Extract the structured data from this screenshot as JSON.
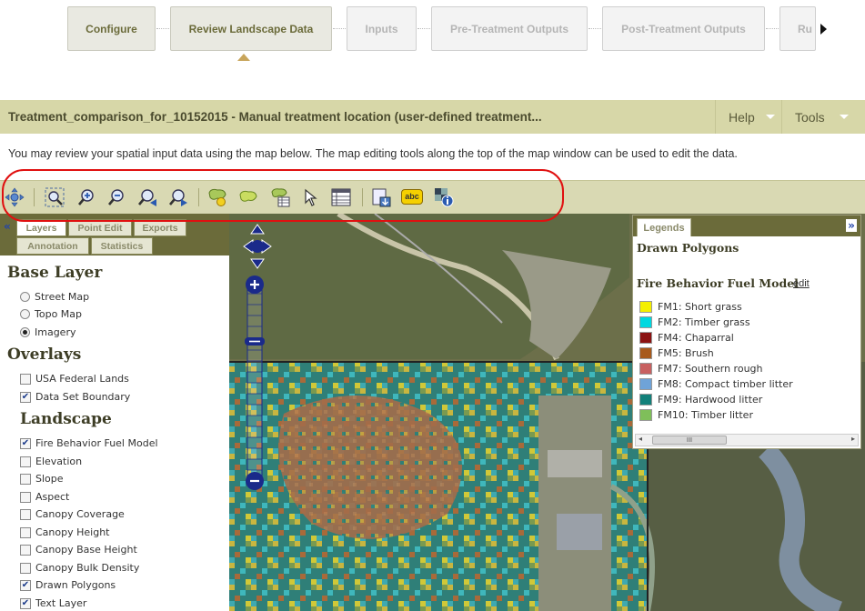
{
  "steps": {
    "items": [
      {
        "label": "Configure",
        "state": "active"
      },
      {
        "label": "Review Landscape Data",
        "state": "current"
      },
      {
        "label": "Inputs",
        "state": "disabled"
      },
      {
        "label": "Pre-Treatment Outputs",
        "state": "disabled"
      },
      {
        "label": "Post-Treatment Outputs",
        "state": "disabled"
      },
      {
        "label": "Ru",
        "state": "disabled"
      }
    ],
    "more_icon": "triangle-right-icon"
  },
  "header": {
    "title": "Treatment_comparison_for_10152015 - Manual treatment location (user-defined treatment...",
    "help_label": "Help",
    "tools_label": "Tools"
  },
  "description": "You may review your spatial input data using the map below. The map editing tools along the top of the map window can be used to edit the data.",
  "toolbar": {
    "icons": [
      "pan-icon",
      "zoom-extent-icon",
      "zoom-in-icon",
      "zoom-out-icon",
      "zoom-previous-icon",
      "zoom-next-icon",
      "add-polygon-icon",
      "edit-polygon-icon",
      "polygon-attributes-icon",
      "select-arrow-icon",
      "table-icon",
      "export-map-icon",
      "label-abc-icon",
      "identify-info-icon"
    ],
    "label_icon_text": "abc"
  },
  "left_panel": {
    "tabs": [
      "Layers",
      "Point Edit",
      "Exports",
      "Annotation",
      "Statistics"
    ],
    "collapse_icon": "double-chevron-left-icon",
    "base_layer_heading": "Base Layer",
    "base_layers": [
      {
        "label": "Street Map",
        "selected": false
      },
      {
        "label": "Topo Map",
        "selected": false
      },
      {
        "label": "Imagery",
        "selected": true
      }
    ],
    "overlays_heading": "Overlays",
    "overlays": [
      {
        "label": "USA Federal Lands",
        "checked": false
      },
      {
        "label": "Data Set Boundary",
        "checked": true
      }
    ],
    "landscape_heading": "Landscape",
    "landscape": [
      {
        "label": "Fire Behavior Fuel Model",
        "checked": true
      },
      {
        "label": "Elevation",
        "checked": false
      },
      {
        "label": "Slope",
        "checked": false
      },
      {
        "label": "Aspect",
        "checked": false
      },
      {
        "label": "Canopy Coverage",
        "checked": false
      },
      {
        "label": "Canopy Height",
        "checked": false
      },
      {
        "label": "Canopy Base Height",
        "checked": false
      },
      {
        "label": "Canopy Bulk Density",
        "checked": false
      },
      {
        "label": "Drawn Polygons",
        "checked": true
      },
      {
        "label": "Text Layer",
        "checked": true
      }
    ]
  },
  "legend": {
    "tab_label": "Legends",
    "expand_icon": "double-chevron-right-icon",
    "drawn_polygons_title": "Drawn Polygons",
    "fuel_model_title": "Fire Behavior Fuel Model",
    "edit_label": "edit",
    "items": [
      {
        "label": "FM1: Short grass",
        "color": "#f5f000"
      },
      {
        "label": "FM2: Timber grass",
        "color": "#00d8e0"
      },
      {
        "label": "FM4: Chaparral",
        "color": "#8b1212"
      },
      {
        "label": "FM5: Brush",
        "color": "#a85a1c"
      },
      {
        "label": "FM7: Southern rough",
        "color": "#c86060"
      },
      {
        "label": "FM8: Compact timber litter",
        "color": "#6fa3d8"
      },
      {
        "label": "FM9: Hardwood litter",
        "color": "#12807a"
      },
      {
        "label": "FM10: Timber litter",
        "color": "#7fbf5a"
      }
    ],
    "scroll_thumb": "III"
  },
  "map": {
    "pan_control": "pan-arrows-icon",
    "zoom_in_icon": "plus-icon",
    "zoom_out_icon": "minus-icon",
    "colors": {
      "imagery": "#6f7a58",
      "boundary": "#222222",
      "river": "#7e8fa0"
    }
  }
}
